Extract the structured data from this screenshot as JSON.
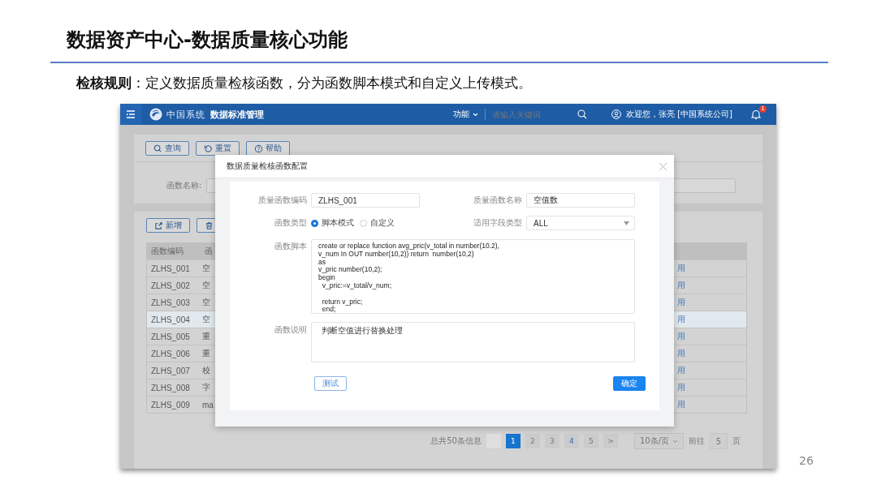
{
  "slide": {
    "title": "数据资产中心-数据质量核心功能",
    "subtitle": "**检核规则**：定义数据质量检核函数，分为函数脚本模式和自定义上传模式。",
    "page_number": "26"
  },
  "app": {
    "header": {
      "brand": "中国系统",
      "title": "数据标准管理",
      "menu": "功能",
      "search": {
        "placeholder": "请输入关键词"
      },
      "user": "欢迎您，张亮 [中国系统公司]",
      "badge": "1"
    },
    "query_buttons": [
      "查询",
      "重置",
      "帮助"
    ],
    "filter": {
      "label": "函数名称:"
    },
    "action_buttons": [
      "新增"
    ],
    "table": {
      "columns": [
        "函数编码",
        "函"
      ],
      "rows": [
        {
          "code": "ZLHS_001",
          "column_2": "空",
          "column_3": "用",
          "selected": false
        },
        {
          "code": "ZLHS_002",
          "column_2": "空",
          "column_3": "用",
          "selected": false
        },
        {
          "code": "ZLHS_003",
          "column_2": "空",
          "column_3": "用",
          "selected": false
        },
        {
          "code": "ZLHS_004",
          "column_2": "空",
          "column_3": "用",
          "selected": true
        },
        {
          "code": "ZLHS_005",
          "column_2": "重",
          "column_3": "用",
          "selected": false
        },
        {
          "code": "ZLHS_006",
          "column_2": "重",
          "column_3": "用",
          "selected": false
        },
        {
          "code": "ZLHS_007",
          "column_2": "校",
          "column_3": "用",
          "selected": false
        },
        {
          "code": "ZLHS_008",
          "column_2": "字",
          "column_3": "用",
          "selected": false
        },
        {
          "code": "ZLHS_009",
          "column_2": "ma",
          "column_3": "用",
          "selected": false
        }
      ]
    },
    "pagination": {
      "total": "总共50条信息",
      "pages": [
        {
          "label": "1",
          "selected": true,
          "hovered": false
        },
        {
          "label": "2",
          "selected": false,
          "hovered": false
        },
        {
          "label": "3",
          "selected": false,
          "hovered": false
        },
        {
          "label": "4",
          "selected": false,
          "hovered": true
        },
        {
          "label": "5",
          "selected": false,
          "hovered": false
        }
      ],
      "next": ">",
      "page_size": "10条/页",
      "goto_label": "前往",
      "goto_value": "5",
      "goto_suffix": "页"
    }
  },
  "dialog": {
    "title": "数据质量检核函数配置",
    "code": {
      "label": "质量函数编码",
      "value": "ZLHS_001"
    },
    "name": {
      "label": "质量函数名称",
      "value": "空值数"
    },
    "type": {
      "label": "函数类型",
      "options": [
        {
          "label": "脚本模式",
          "selected": true
        },
        {
          "label": "自定义",
          "selected": false
        }
      ]
    },
    "field_type": {
      "label": "适用字段类型",
      "value": "ALL"
    },
    "script": {
      "label": "函数脚本",
      "value": "create or replace function avg_pric(v_total in number(10.2),\nv_num In OUT number(10,2)) return  number(10,2)\nas\nv_pric number(10,2);\nbegin\n  v_pric:=v_total/v_num;\n\n  return v_pric;\n  end;"
    },
    "description": {
      "label": "函数说明",
      "value": "判断空值进行替换处理"
    },
    "buttons": [
      {
        "label": "测试",
        "kind": "secondary"
      },
      {
        "label": "确定",
        "kind": "primary"
      }
    ]
  }
}
